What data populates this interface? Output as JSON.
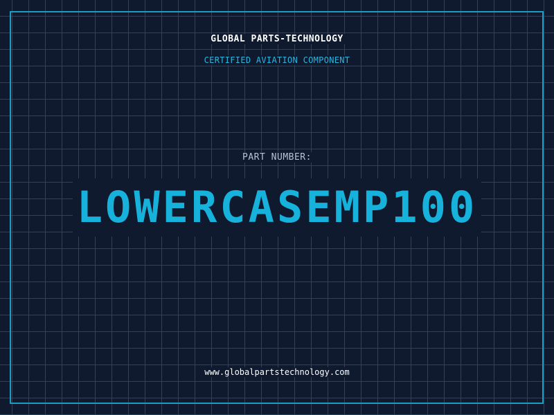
{
  "header": {
    "company": "GLOBAL PARTS-TECHNOLOGY",
    "tagline": "CERTIFIED AVIATION COMPONENT"
  },
  "main": {
    "label": "PART NUMBER:",
    "part_number": "LOWERCASEMP100"
  },
  "footer": {
    "url": "www.globalpartstechnology.com"
  },
  "colors": {
    "background": "#0f1a2f",
    "grid": "#1f4766",
    "accent": "#17b2db",
    "frame": "#1d9bc2"
  }
}
